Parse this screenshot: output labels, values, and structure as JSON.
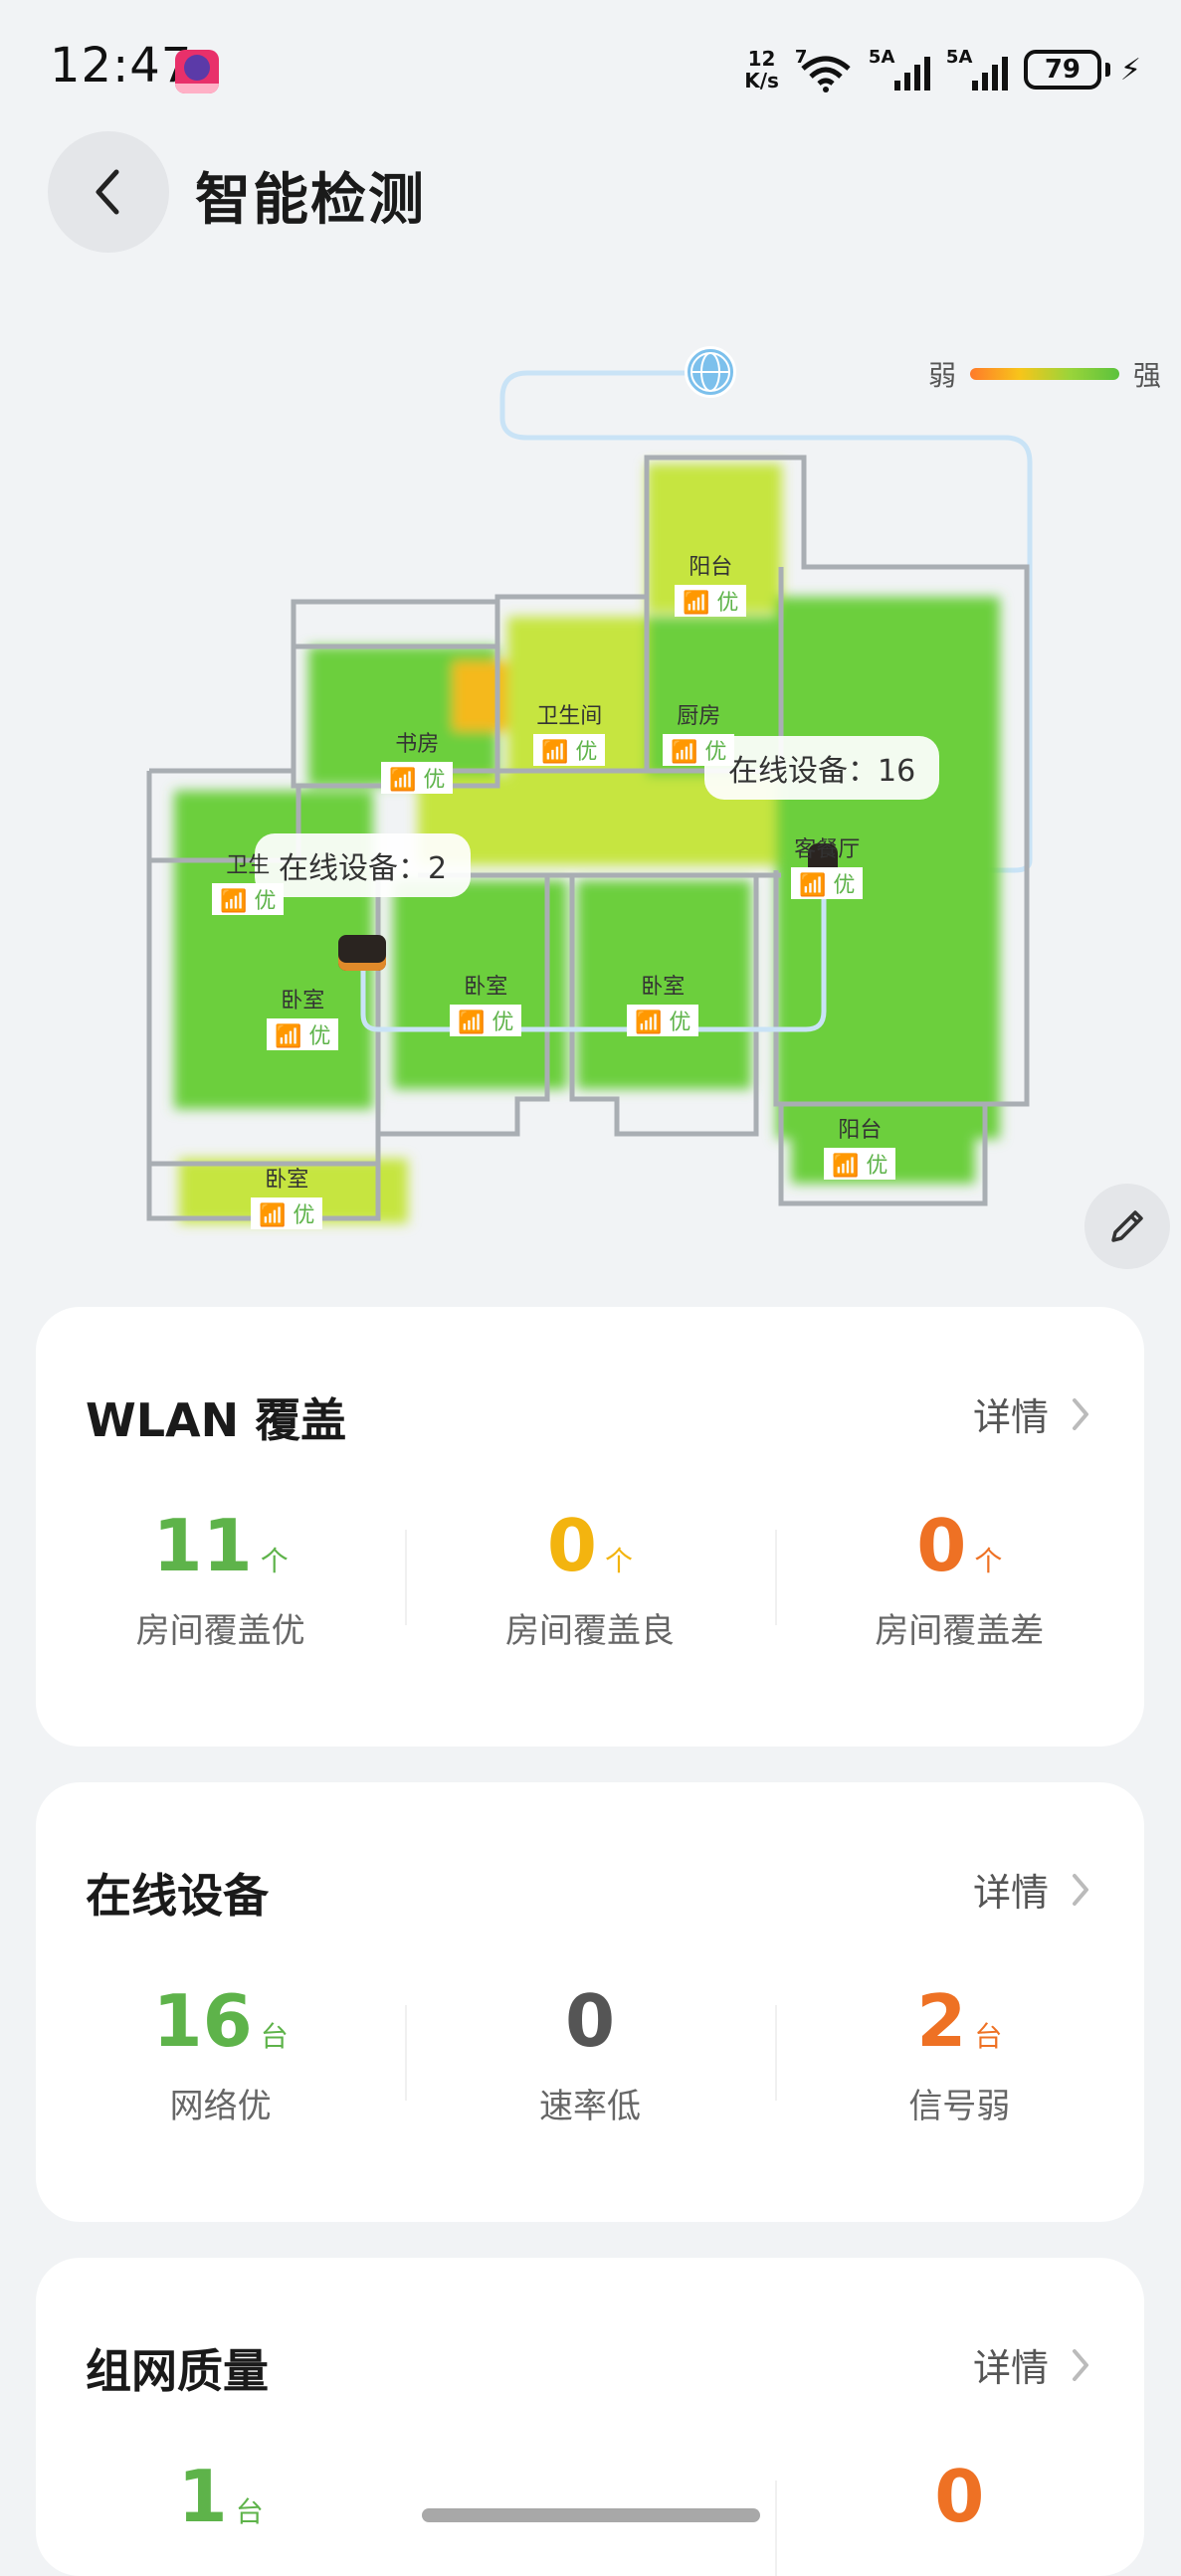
{
  "status_bar": {
    "time": "12:47",
    "net_speed_value": "12",
    "net_speed_unit": "K/s",
    "wifi_badge": "7",
    "signal1_tag": "5A",
    "signal2_tag": "5A",
    "battery": "79",
    "icons": [
      "app-badge-icon",
      "wifi-icon",
      "signal-icon",
      "battery-icon",
      "charging-icon"
    ]
  },
  "header": {
    "title": "智能检测",
    "back_icon": "chevron-left-icon"
  },
  "map": {
    "legend": {
      "weak": "弱",
      "strong": "强"
    },
    "signal_label": "优",
    "rooms": [
      "阳台",
      "书房",
      "卫生间",
      "厨房",
      "卫生",
      "客餐厅",
      "卧室",
      "卧室",
      "卧室",
      "卧室",
      "阳台"
    ],
    "callouts": [
      {
        "text": "在线设备：16"
      },
      {
        "text": "在线设备：2"
      }
    ],
    "edit_icon": "pencil-icon",
    "colors": {
      "excellent": "#6ccf3d",
      "good": "#c6e540",
      "weak": "#f5b91f",
      "wall": "#a9aeb3"
    }
  },
  "wlan_card": {
    "title": "WLAN 覆盖",
    "detail": "详情",
    "stats": [
      {
        "value": "11",
        "unit": "个",
        "label": "房间覆盖优",
        "color": "#5eb34a"
      },
      {
        "value": "0",
        "unit": "个",
        "label": "房间覆盖良",
        "color": "#f3b40f"
      },
      {
        "value": "0",
        "unit": "个",
        "label": "房间覆盖差",
        "color": "#ee7124"
      }
    ]
  },
  "devices_card": {
    "title": "在线设备",
    "detail": "详情",
    "stats": [
      {
        "value": "16",
        "unit": "台",
        "label": "网络优",
        "color": "#5eb34a"
      },
      {
        "value": "0",
        "unit": "",
        "label": "速率低",
        "color": "#555555"
      },
      {
        "value": "2",
        "unit": "台",
        "label": "信号弱",
        "color": "#ee7124"
      }
    ]
  },
  "network_card": {
    "title": "组网质量",
    "detail": "详情",
    "stats": [
      {
        "value": "1",
        "unit": "台",
        "color": "#5eb34a"
      },
      {
        "value": "0",
        "unit": "",
        "color": "#ee7124"
      }
    ]
  }
}
